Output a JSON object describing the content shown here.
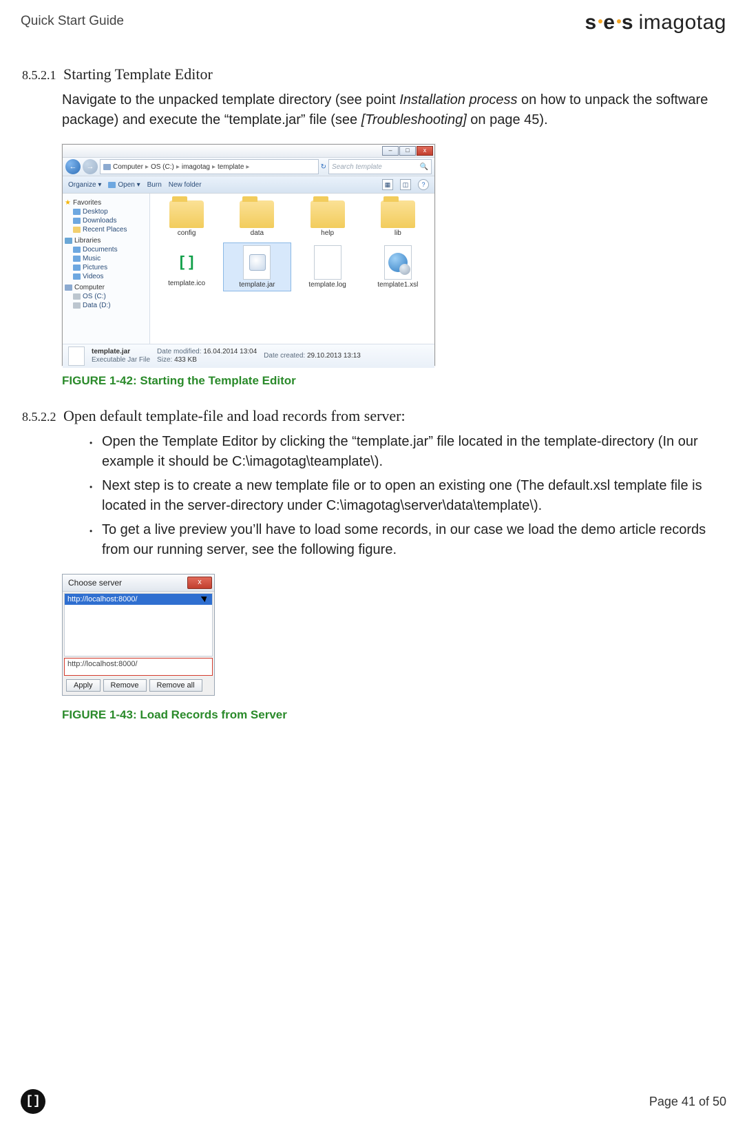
{
  "header": {
    "title": "Quick Start Guide",
    "logo_bold": "ses",
    "logo_light": "imagotag"
  },
  "section1": {
    "num": "8.5.2.1",
    "title": "Starting Template Editor",
    "para_a": "Navigate to the unpacked template directory (see point ",
    "para_em1": "Installation process",
    "para_b": " on how to unpack the software package) and execute the “template.jar” file (see ",
    "para_em2": "[Troubleshooting]",
    "para_c": " on page 45)."
  },
  "explorer": {
    "win_min": "–",
    "win_max": "□",
    "win_close": "x",
    "breadcrumb": [
      "Computer",
      "OS (C:)",
      "imagotag",
      "template"
    ],
    "search_placeholder": "Search template",
    "toolbar": {
      "organize": "Organize ▾",
      "open": "Open ▾",
      "burn": "Burn",
      "newfolder": "New folder",
      "help": "?"
    },
    "sidebar": {
      "favorites": {
        "head": "Favorites",
        "items": [
          "Desktop",
          "Downloads",
          "Recent Places"
        ]
      },
      "libraries": {
        "head": "Libraries",
        "items": [
          "Documents",
          "Music",
          "Pictures",
          "Videos"
        ]
      },
      "computer": {
        "head": "Computer",
        "items": [
          "OS (C:)",
          "Data (D:)"
        ]
      }
    },
    "files": {
      "folders": [
        "config",
        "data",
        "help",
        "lib"
      ],
      "items": [
        {
          "name": "template.ico",
          "type": "ico"
        },
        {
          "name": "template.jar",
          "type": "jar",
          "selected": true
        },
        {
          "name": "template.log",
          "type": "log"
        },
        {
          "name": "template1.xsl",
          "type": "xsl"
        }
      ]
    },
    "details": {
      "name": "template.jar",
      "type": "Executable Jar File",
      "mod_label": "Date modified:",
      "mod": "16.04.2014 13:04",
      "size_label": "Size:",
      "size": "433 KB",
      "created_label": "Date created:",
      "created": "29.10.2013 13:13"
    }
  },
  "fig1": "FIGURE 1-42: Starting the Template Editor",
  "section2": {
    "num": "8.5.2.2",
    "title": "Open default template-file and load records from server:",
    "bullets": [
      "Open the Template Editor by clicking the “template.jar” file located in the template-directory (In our example it should be C:\\imagotag\\teamplate\\).",
      "Next step is to create a new template file or to open an existing one (The default.xsl template file is located in the server-directory under C:\\imagotag\\server\\data\\template\\).",
      "To get a live preview you’ll have to load some records, in our case we load the demo article records from our running server, see the following figure."
    ]
  },
  "dialog": {
    "title": "Choose server",
    "list_item": "http://localhost:8000/",
    "input": "http://localhost:8000/",
    "apply": "Apply",
    "remove": "Remove",
    "remove_all": "Remove all"
  },
  "fig2": "FIGURE 1-43: Load Records from Server",
  "footer": {
    "logo": "[]",
    "page": "Page 41 of 50"
  }
}
